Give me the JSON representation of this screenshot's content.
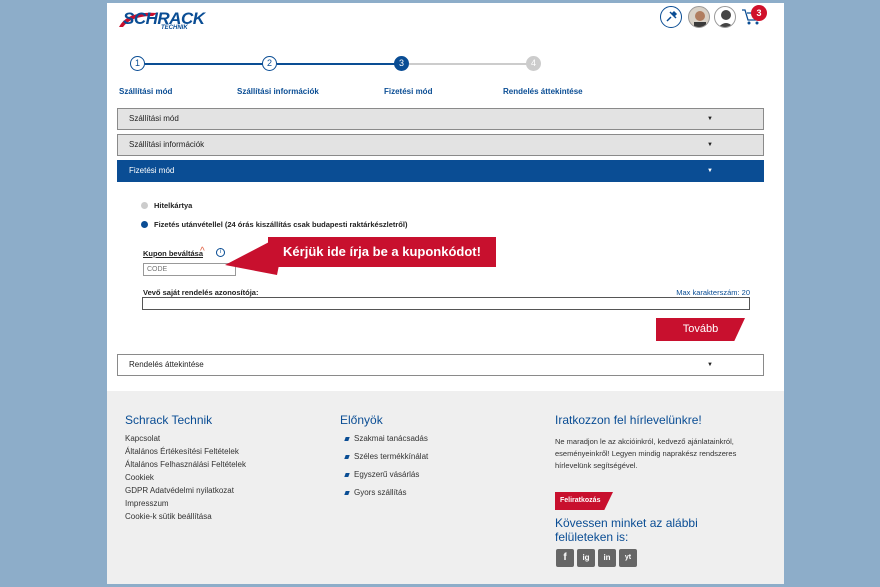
{
  "header": {
    "logo_text": "SCHRACK",
    "logo_sub": "TECHNIK",
    "cart_count": "3"
  },
  "steps": [
    {
      "number": "1",
      "label": "Szállítási mód",
      "state": "done"
    },
    {
      "number": "2",
      "label": "Szállítási információk",
      "state": "done"
    },
    {
      "number": "3",
      "label": "Fizetési mód",
      "state": "active"
    },
    {
      "number": "4",
      "label": "Rendelés áttekintése",
      "state": "pending"
    }
  ],
  "accordion": {
    "shipping_mode": "Szállítási mód",
    "shipping_info": "Szállítási információk",
    "payment_mode": "Fizetési mód",
    "order_review": "Rendelés áttekintése",
    "caret": "▼"
  },
  "payment": {
    "option_card": "Hitelkártya",
    "option_cod": "Fizetés utánvétellel (24 órás kiszállítás csak budapesti raktárkészletről)",
    "coupon_label": "Kupon beváltása",
    "coupon_placeholder": "CODE",
    "callout": "Kérjük ide írja be a kuponkódot!",
    "order_id_label": "Vevő saját rendelés azonosítója:",
    "max_chars": "Max karakterszám: 20",
    "next_button": "Tovább"
  },
  "footer": {
    "col1_title": "Schrack Technik",
    "col1_links": [
      "Kapcsolat",
      "Általános Értékesítési Feltételek",
      "Általános Felhasználási Feltételek",
      "Cookiek",
      "GDPR Adatvédelmi nyilatkozat",
      "Impresszum",
      "Cookie-k sütik beállítása"
    ],
    "col2_title": "Előnyök",
    "col2_items": [
      "Szakmai tanácsadás",
      "Széles termékkínálat",
      "Egyszerű vásárlás",
      "Gyors szállítás"
    ],
    "col3_title": "Iratkozzon fel hírlevelünkre!",
    "col3_text": "Ne maradjon le az akcióinkról, kedvező ajánlatainkról, eseményeinkről! Legyen mindig naprakész rendszeres hírlevelünk segítségével.",
    "subscribe_button": "Feliratkozás",
    "follow_text": "Kövessen minket az alábbi felületeken is:",
    "social": [
      "f",
      "ig",
      "in",
      "yt"
    ]
  },
  "colors": {
    "brand_blue": "#0a4d94",
    "brand_red": "#c8102e",
    "background": "#8dadc9"
  }
}
